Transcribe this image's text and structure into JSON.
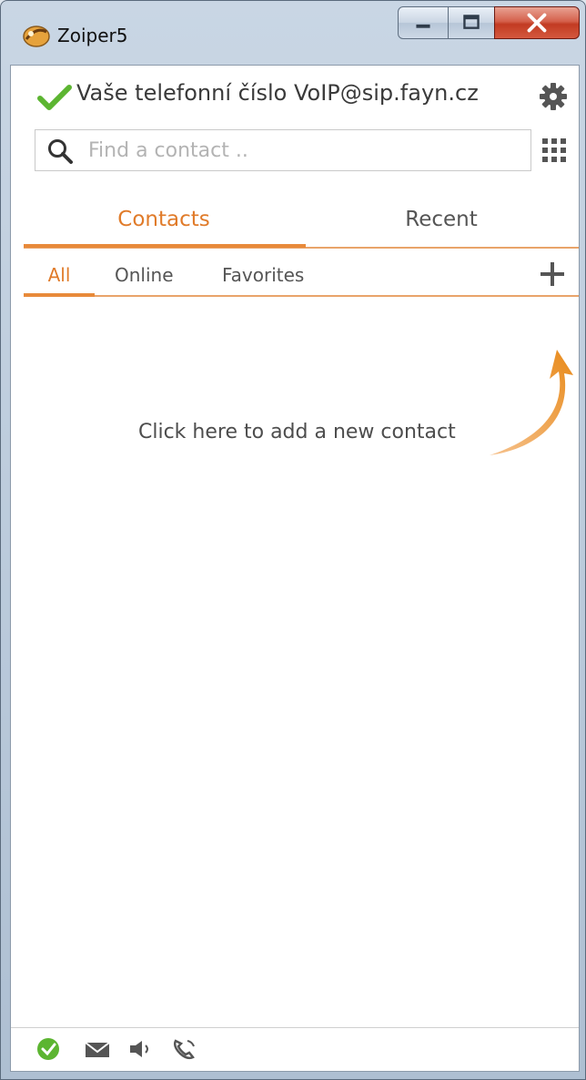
{
  "window": {
    "title": "Zoiper5"
  },
  "status": {
    "account_label": "Vaše telefonní číslo VoIP@sip.fayn.cz",
    "state_color": "#5cb531"
  },
  "search": {
    "placeholder": "Find a contact ..",
    "value": ""
  },
  "main_tabs": [
    {
      "label": "Contacts",
      "active": true
    },
    {
      "label": "Recent",
      "active": false
    }
  ],
  "sub_tabs": [
    {
      "label": "All",
      "active": true
    },
    {
      "label": "Online",
      "active": false
    },
    {
      "label": "Favorites",
      "active": false
    }
  ],
  "empty_state": {
    "hint": "Click here to add a new contact"
  },
  "colors": {
    "accent": "#e07b2a",
    "text": "#3a3a3a"
  },
  "icons": {
    "app": "zoiper-logo-icon",
    "status": "checkmark-icon",
    "settings": "gear-icon",
    "search": "search-icon",
    "dialpad": "dialpad-icon",
    "add": "plus-icon",
    "footer": [
      "online-status-icon",
      "mail-icon",
      "speaker-icon",
      "phone-icon"
    ]
  }
}
